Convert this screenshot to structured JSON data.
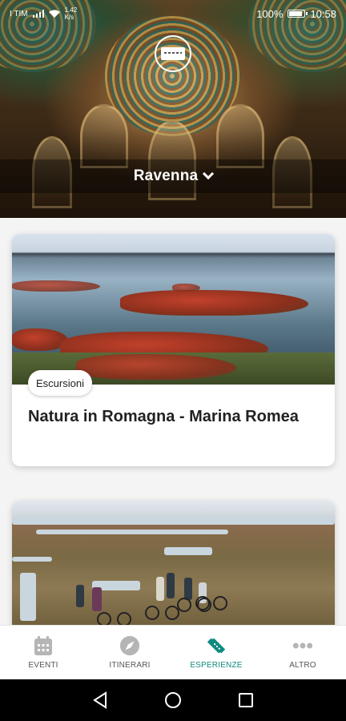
{
  "status_bar": {
    "carrier": "I TIM",
    "speed_value": "1.42",
    "speed_unit": "K/s",
    "battery": "100%",
    "time": "10:58"
  },
  "header": {
    "city": "Ravenna"
  },
  "cards": [
    {
      "category": "Escursioni",
      "title": "Natura in Romagna - Marina Romea"
    }
  ],
  "bottom_nav": [
    {
      "label": "EVENTI",
      "icon": "calendar-icon",
      "active": false
    },
    {
      "label": "ITINERARI",
      "icon": "compass-icon",
      "active": false
    },
    {
      "label": "ESPERIENZE",
      "icon": "ticket-icon",
      "active": true
    },
    {
      "label": "ALTRO",
      "icon": "more-dots-icon",
      "active": false
    }
  ],
  "colors": {
    "accent": "#0f8a7e",
    "nav_inactive": "#555555"
  }
}
